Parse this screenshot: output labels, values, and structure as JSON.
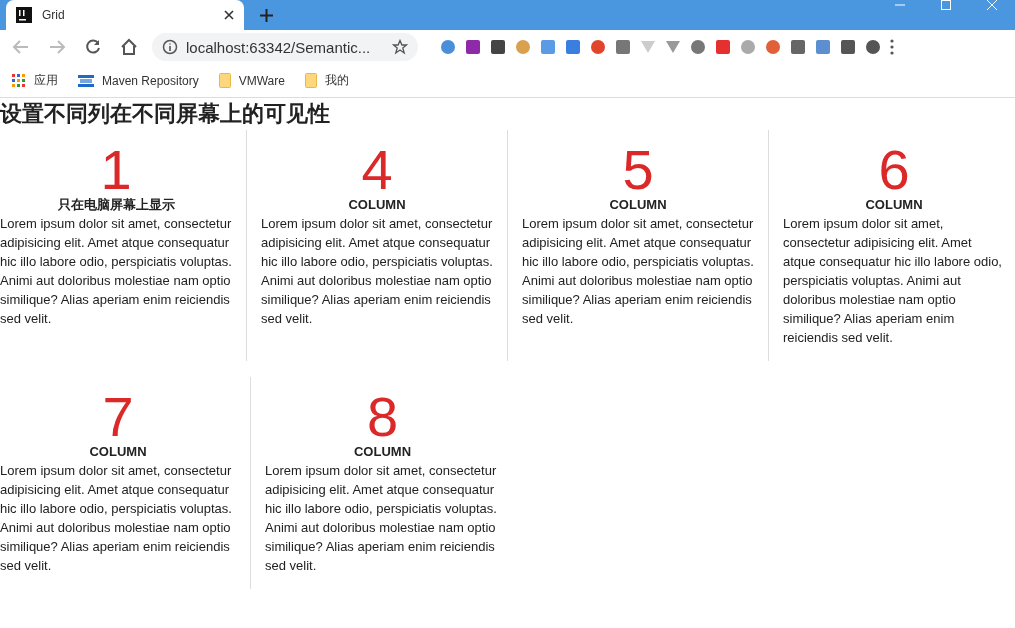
{
  "browser": {
    "tab_title": "Grid",
    "url": "localhost:63342/Semantic...",
    "bookmarks": [
      {
        "label": "应用",
        "kind": "apps"
      },
      {
        "label": "Maven Repository",
        "kind": "site"
      },
      {
        "label": "VMWare",
        "kind": "folder"
      },
      {
        "label": "我的",
        "kind": "folder"
      }
    ]
  },
  "heading": "设置不同列在不同屏幕上的可见性",
  "rows": [
    [
      {
        "number": "1",
        "header": "只在电脑屏幕上显示",
        "text": "Lorem ipsum dolor sit amet, consectetur adipisicing elit. Amet atque consequatur hic illo labore odio, perspiciatis voluptas. Animi aut doloribus molestiae nam optio similique? Alias aperiam enim reiciendis sed velit."
      },
      {
        "number": "4",
        "header": "COLUMN",
        "text": "Lorem ipsum dolor sit amet, consectetur adipisicing elit. Amet atque consequatur hic illo labore odio, perspiciatis voluptas. Animi aut doloribus molestiae nam optio similique? Alias aperiam enim reiciendis sed velit."
      },
      {
        "number": "5",
        "header": "COLUMN",
        "text": "Lorem ipsum dolor sit amet, consectetur adipisicing elit. Amet atque consequatur hic illo labore odio, perspiciatis voluptas. Animi aut doloribus molestiae nam optio similique? Alias aperiam enim reiciendis sed velit."
      },
      {
        "number": "6",
        "header": "COLUMN",
        "text": "Lorem ipsum dolor sit amet, consectetur adipisicing elit. Amet atque consequatur hic illo labore odio, perspiciatis voluptas. Animi aut doloribus molestiae nam optio similique? Alias aperiam enim reiciendis sed velit."
      }
    ],
    [
      {
        "number": "7",
        "header": "COLUMN",
        "text": "Lorem ipsum dolor sit amet, consectetur adipisicing elit. Amet atque consequatur hic illo labore odio, perspiciatis voluptas. Animi aut doloribus molestiae nam optio similique? Alias aperiam enim reiciendis sed velit."
      },
      {
        "number": "8",
        "header": "COLUMN",
        "text": "Lorem ipsum dolor sit amet, consectetur adipisicing elit. Amet atque consequatur hic illo labore odio, perspiciatis voluptas. Animi aut doloribus molestiae nam optio similique? Alias aperiam enim reiciendis sed velit."
      }
    ]
  ]
}
